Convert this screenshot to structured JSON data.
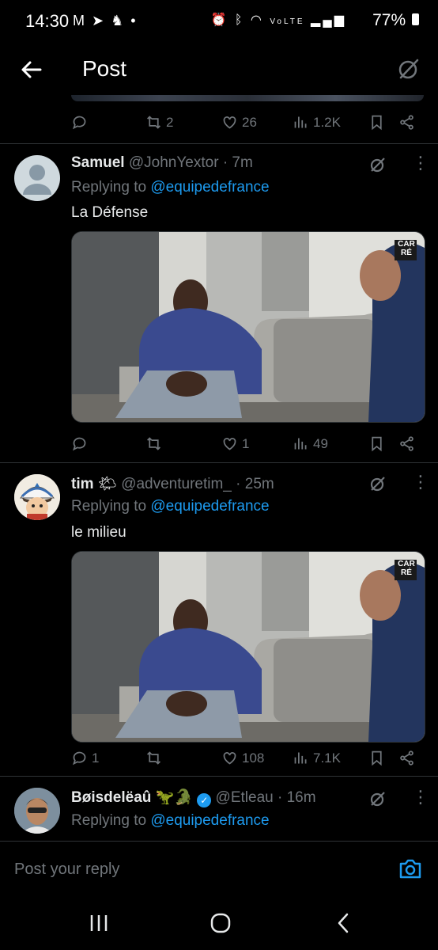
{
  "status_bar": {
    "time": "14:30",
    "battery": "77%",
    "notif_icons": [
      "gmail-icon",
      "telegram-icon",
      "snapchat-icon",
      "dot-icon"
    ],
    "system_icons": [
      "alarm-icon",
      "bluetooth-icon",
      "wifi-icon",
      "volte-icon",
      "signal-icon",
      "battery-icon"
    ]
  },
  "header": {
    "title": "Post"
  },
  "top_post_actions": {
    "reposts": "2",
    "likes": "26",
    "views": "1.2K"
  },
  "posts": [
    {
      "name": "Samuel",
      "handle": "@JohnYextor",
      "time": "· 7m",
      "replying_prefix": "Replying to",
      "replying_to": "@equipedefrance",
      "text": "La Défense",
      "replies": "",
      "reposts": "",
      "likes": "1",
      "views": "49"
    },
    {
      "name": "tim",
      "name_emoji": "🌤",
      "handle": "@adventuretim_",
      "time": "· 25m",
      "replying_prefix": "Replying to",
      "replying_to": "@equipedefrance",
      "text": "le milieu",
      "replies": "1",
      "reposts": "",
      "likes": "108",
      "views": "7.1K"
    },
    {
      "name": "Bøisdelëaû",
      "name_emoji": "🦖🐊",
      "handle": "@Etleau",
      "time": "· 16m",
      "replying_prefix": "Replying to",
      "replying_to": "@equipedefrance"
    }
  ],
  "media_badge": "CAR RÉ",
  "reply_box": {
    "placeholder": "Post your reply"
  },
  "colors": {
    "accent": "#1d9bf0",
    "muted": "#71767b",
    "background": "#000000",
    "divider": "#2f3336"
  }
}
